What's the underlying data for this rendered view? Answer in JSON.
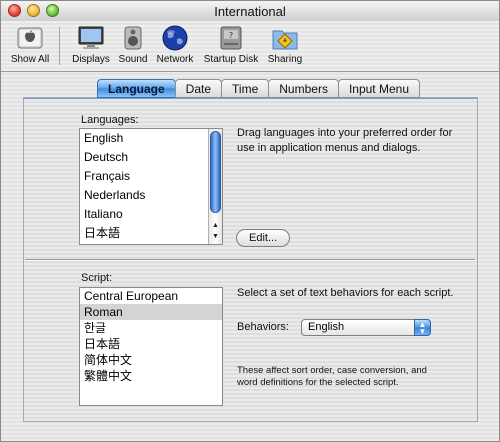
{
  "window": {
    "title": "International"
  },
  "toolbar": {
    "items": [
      {
        "label": "Show All",
        "icon": "apple-logo-icon"
      },
      {
        "label": "Displays",
        "icon": "display-icon"
      },
      {
        "label": "Sound",
        "icon": "speaker-icon"
      },
      {
        "label": "Network",
        "icon": "globe-icon"
      },
      {
        "label": "Startup Disk",
        "icon": "hard-disk-icon"
      },
      {
        "label": "Sharing",
        "icon": "folder-sharing-icon"
      }
    ]
  },
  "tabs": [
    "Language",
    "Date",
    "Time",
    "Numbers",
    "Input Menu"
  ],
  "active_tab": "Language",
  "languages": {
    "label": "Languages:",
    "items": [
      "English",
      "Deutsch",
      "Français",
      "Nederlands",
      "Italiano",
      "日本語"
    ],
    "description": "Drag languages into your preferred order for use in application menus and dialogs.",
    "edit_button": "Edit..."
  },
  "script": {
    "label": "Script:",
    "items": [
      "Central European",
      "Roman",
      "한글",
      "日本語",
      "简体中文",
      "繁體中文"
    ],
    "selected": "Roman",
    "description": "Select a set of text behaviors for each script.",
    "behaviors_label": "Behaviors:",
    "behaviors_value": "English",
    "note": "These affect sort order, case conversion, and word definitions for the selected script."
  },
  "colors": {
    "accent": "#3f8be0",
    "selection": "#d4d4d4"
  }
}
